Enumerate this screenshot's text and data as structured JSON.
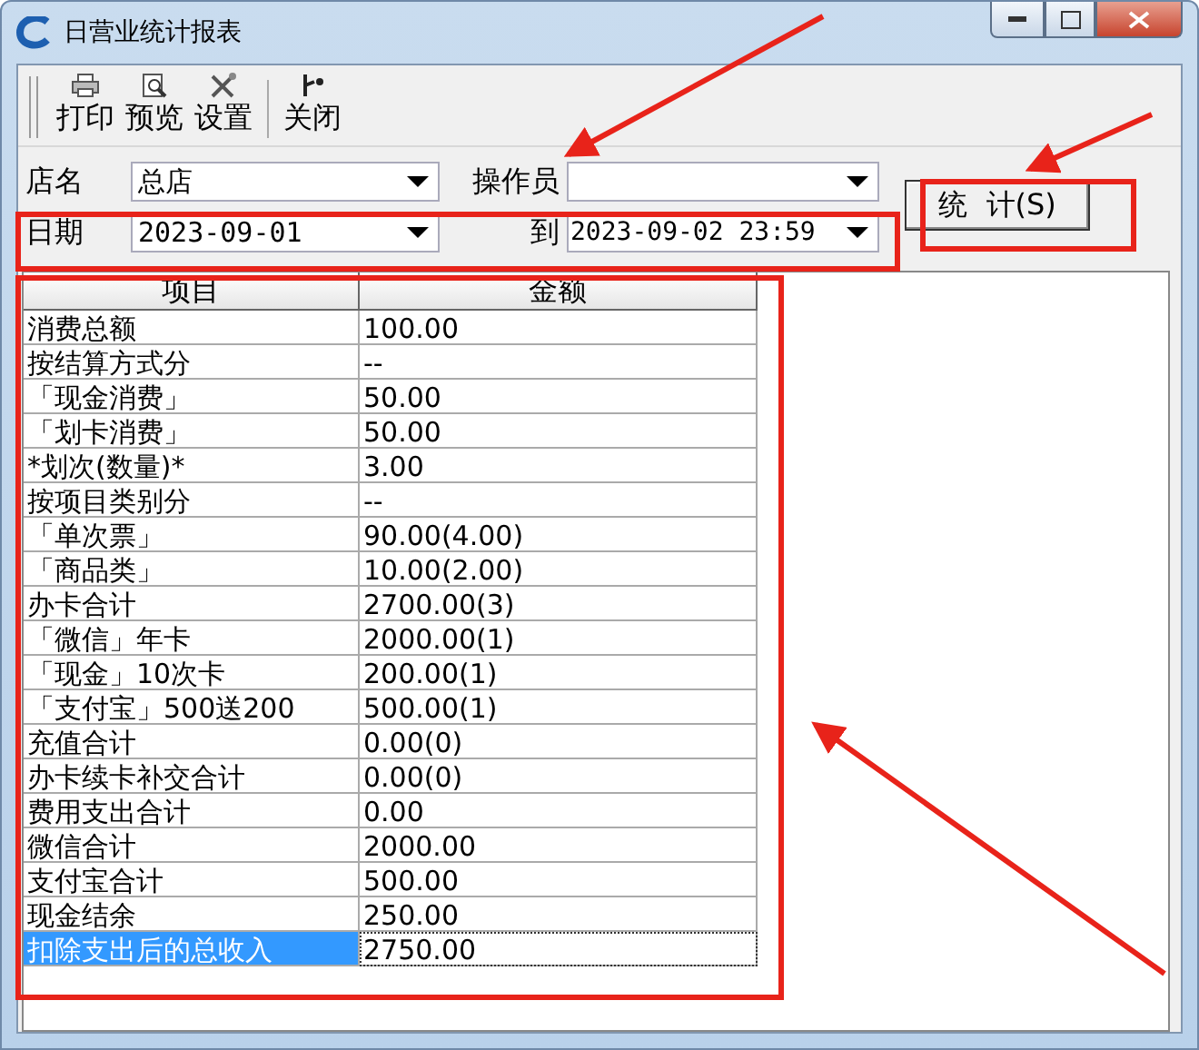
{
  "window": {
    "title": "日营业统计报表"
  },
  "toolbar": [
    {
      "label": "打印",
      "kind": "print"
    },
    {
      "label": "预览",
      "kind": "preview"
    },
    {
      "label": "设置",
      "kind": "settings"
    },
    {
      "label": "关闭",
      "kind": "close"
    }
  ],
  "filters": {
    "store": {
      "label": "店名",
      "value": "总店"
    },
    "operator": {
      "label": "操作员"
    },
    "date_from": {
      "label": "日期",
      "value": "2023-09-01"
    },
    "date_to": {
      "label": "到",
      "value": "2023-09-02 23:59"
    }
  },
  "stats_button": "统  计(S)",
  "table": {
    "columns": [
      "项目",
      "金额"
    ],
    "rows": [
      {
        "item": "消费总额",
        "amount": "100.00",
        "selected": false
      },
      {
        "item": "按结算方式分",
        "amount": "--",
        "selected": false
      },
      {
        "item": "「现金消费」",
        "amount": "50.00",
        "selected": false
      },
      {
        "item": "「划卡消费」",
        "amount": "50.00",
        "selected": false
      },
      {
        "item": "*划次(数量)*",
        "amount": "3.00",
        "selected": false
      },
      {
        "item": "按项目类别分",
        "amount": "--",
        "selected": false
      },
      {
        "item": "「单次票」",
        "amount": "90.00(4.00)",
        "selected": false
      },
      {
        "item": "「商品类」",
        "amount": "10.00(2.00)",
        "selected": false
      },
      {
        "item": "办卡合计",
        "amount": "2700.00(3)",
        "selected": false
      },
      {
        "item": "「微信」年卡",
        "amount": "2000.00(1)",
        "selected": false
      },
      {
        "item": "「现金」10次卡",
        "amount": "200.00(1)",
        "selected": false
      },
      {
        "item": "「支付宝」500送200",
        "amount": "500.00(1)",
        "selected": false
      },
      {
        "item": "充值合计",
        "amount": "0.00(0)",
        "selected": false
      },
      {
        "item": "办卡续卡补交合计",
        "amount": "0.00(0)",
        "selected": false
      },
      {
        "item": "费用支出合计",
        "amount": "0.00",
        "selected": false
      },
      {
        "item": "微信合计",
        "amount": "2000.00",
        "selected": false
      },
      {
        "item": "支付宝合计",
        "amount": "500.00",
        "selected": false
      },
      {
        "item": "现金结余",
        "amount": "250.00",
        "selected": false
      },
      {
        "item": "扣除支出后的总收入",
        "amount": "2750.00",
        "selected": true
      }
    ]
  }
}
